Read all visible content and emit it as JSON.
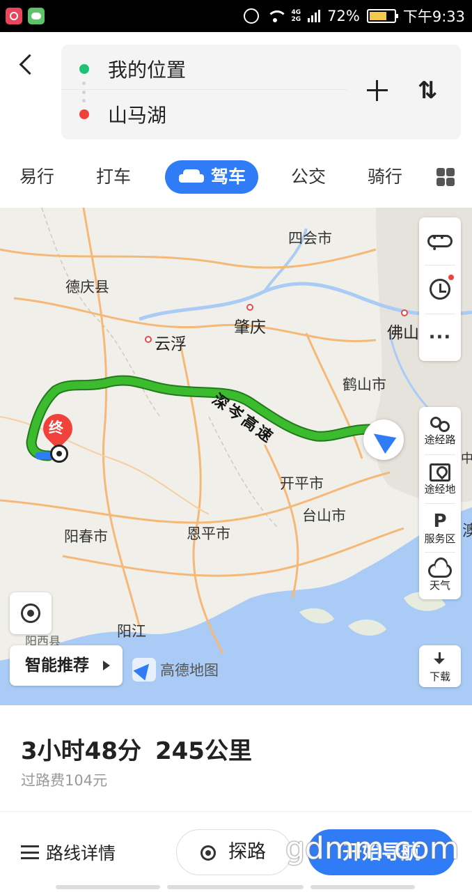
{
  "status_bar": {
    "battery": "72%",
    "time": "下午9:33",
    "network": "4G 2G",
    "battery_color": "#f2c94c"
  },
  "route": {
    "origin": "我的位置",
    "destination": "山马湖"
  },
  "tabs": [
    "易行",
    "打车",
    "驾车",
    "公交",
    "骑行"
  ],
  "active_tab": "驾车",
  "map": {
    "cities": {
      "sihui": "四会市",
      "deqing": "德庆县",
      "zhaoqing": "肇庆",
      "yunfu": "云浮",
      "foshan": "佛山",
      "heshan": "鹤山市",
      "kaiping": "开平市",
      "taishan": "台山市",
      "yangchun": "阳春市",
      "enping": "恩平市",
      "yangjiang": "阳江",
      "yangxi": "阳西县",
      "macau_partial": "澳",
      "zhongshan_partial": "中山"
    },
    "road_label": "深岑高速",
    "end_label": "终",
    "logo": "高德地图",
    "route_color": "#3cbb2f",
    "accent": "#2f7cf6"
  },
  "side_panel": {
    "waypoint_route": "途经路",
    "waypoint_place": "途经地",
    "service_area": "服务区",
    "weather": "天气"
  },
  "smart_recommend": "智能推荐",
  "download": "下载",
  "summary": {
    "duration": "3小时48分",
    "distance": "245公里",
    "toll": "过路费104元"
  },
  "actions": {
    "details": "路线详情",
    "explore": "探路",
    "start_nav": "开始导航"
  },
  "watermark": "gdmm.com"
}
